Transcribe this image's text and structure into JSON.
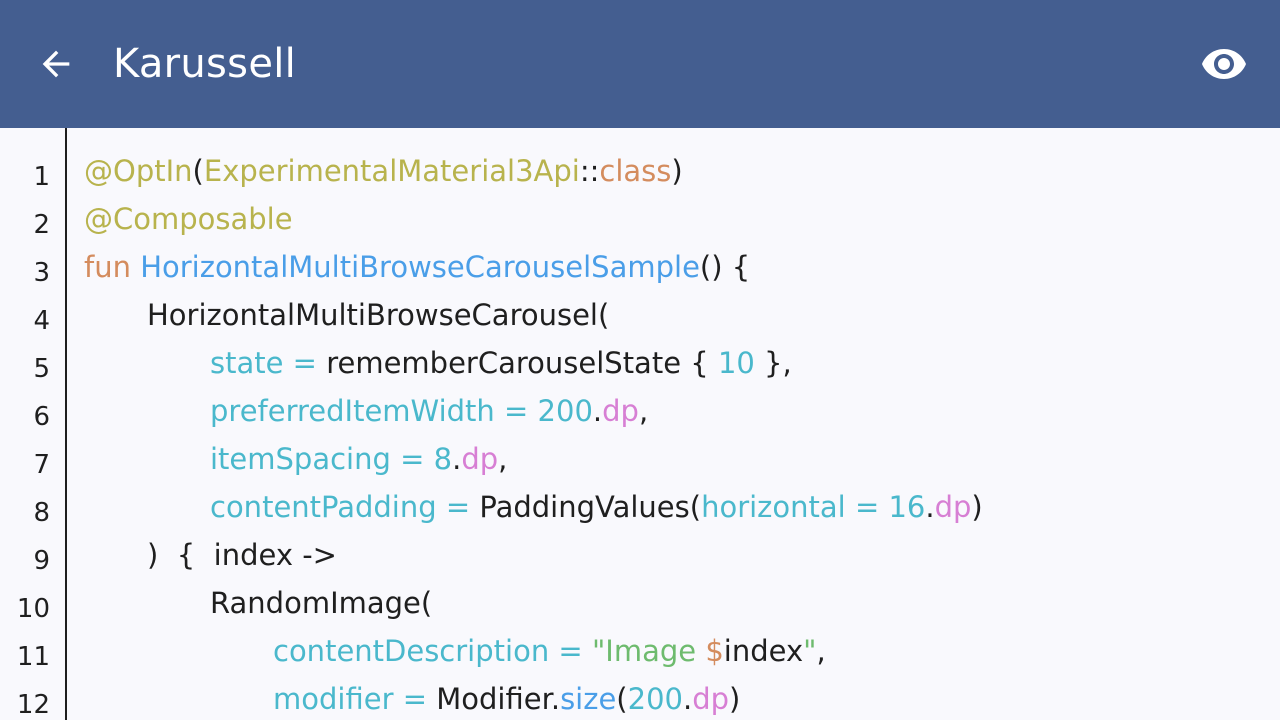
{
  "appbar": {
    "title": "Karussell",
    "back_icon": "arrow-back-icon",
    "preview_icon": "eye-icon",
    "background": "#445e90"
  },
  "colors": {
    "annotation": "#b8b34d",
    "keyword": "#d48c5e",
    "function": "#4a9ee8",
    "param": "#4ab8cc",
    "unit": "#d77fd4",
    "string": "#6ebb6e",
    "plain": "#1f1f1f"
  },
  "code": {
    "lines": [
      {
        "number": "1",
        "indent": 0,
        "tokens": [
          {
            "t": "@OptIn",
            "c": "annotation"
          },
          {
            "t": "(",
            "c": "plain"
          },
          {
            "t": "ExperimentalMaterial3Api",
            "c": "annotation"
          },
          {
            "t": "::",
            "c": "plain"
          },
          {
            "t": "class",
            "c": "keyword"
          },
          {
            "t": ")",
            "c": "plain"
          }
        ]
      },
      {
        "number": "2",
        "indent": 0,
        "tokens": [
          {
            "t": "@Composable",
            "c": "annotation"
          }
        ]
      },
      {
        "number": "3",
        "indent": 0,
        "tokens": [
          {
            "t": "fun ",
            "c": "keyword"
          },
          {
            "t": "HorizontalMultiBrowseCarouselSample",
            "c": "function"
          },
          {
            "t": "() {",
            "c": "plain"
          }
        ]
      },
      {
        "number": "4",
        "indent": 1,
        "tokens": [
          {
            "t": "HorizontalMultiBrowseCarousel(",
            "c": "plain"
          }
        ]
      },
      {
        "number": "5",
        "indent": 2,
        "tokens": [
          {
            "t": "state = ",
            "c": "param"
          },
          {
            "t": "rememberCarouselState { ",
            "c": "plain"
          },
          {
            "t": "10",
            "c": "param"
          },
          {
            "t": " },",
            "c": "plain"
          }
        ]
      },
      {
        "number": "6",
        "indent": 2,
        "tokens": [
          {
            "t": "preferredItemWidth = 200",
            "c": "param"
          },
          {
            "t": ".",
            "c": "plain"
          },
          {
            "t": "dp",
            "c": "unit"
          },
          {
            "t": ",",
            "c": "plain"
          }
        ]
      },
      {
        "number": "7",
        "indent": 2,
        "tokens": [
          {
            "t": "itemSpacing = 8",
            "c": "param"
          },
          {
            "t": ".",
            "c": "plain"
          },
          {
            "t": "dp",
            "c": "unit"
          },
          {
            "t": ",",
            "c": "plain"
          }
        ]
      },
      {
        "number": "8",
        "indent": 2,
        "tokens": [
          {
            "t": "contentPadding = ",
            "c": "param"
          },
          {
            "t": "PaddingValues(",
            "c": "plain"
          },
          {
            "t": "horizontal = 16",
            "c": "param"
          },
          {
            "t": ".",
            "c": "plain"
          },
          {
            "t": "dp",
            "c": "unit"
          },
          {
            "t": ")",
            "c": "plain"
          }
        ]
      },
      {
        "number": "9",
        "indent": 1,
        "tokens": [
          {
            "t": ")  {  index ->",
            "c": "plain"
          }
        ]
      },
      {
        "number": "10",
        "indent": 2,
        "tokens": [
          {
            "t": "RandomImage(",
            "c": "plain"
          }
        ]
      },
      {
        "number": "11",
        "indent": 3,
        "tokens": [
          {
            "t": "contentDescription = ",
            "c": "param"
          },
          {
            "t": "\"Image ",
            "c": "string"
          },
          {
            "t": "$",
            "c": "keyword"
          },
          {
            "t": "index",
            "c": "plain"
          },
          {
            "t": "\"",
            "c": "string"
          },
          {
            "t": ",",
            "c": "plain"
          }
        ]
      },
      {
        "number": "12",
        "indent": 3,
        "tokens": [
          {
            "t": "modifier = ",
            "c": "param"
          },
          {
            "t": "Modifier.",
            "c": "plain"
          },
          {
            "t": "size",
            "c": "function"
          },
          {
            "t": "(",
            "c": "plain"
          },
          {
            "t": "200",
            "c": "param"
          },
          {
            "t": ".",
            "c": "plain"
          },
          {
            "t": "dp",
            "c": "unit"
          },
          {
            "t": ")",
            "c": "plain"
          }
        ]
      }
    ]
  }
}
